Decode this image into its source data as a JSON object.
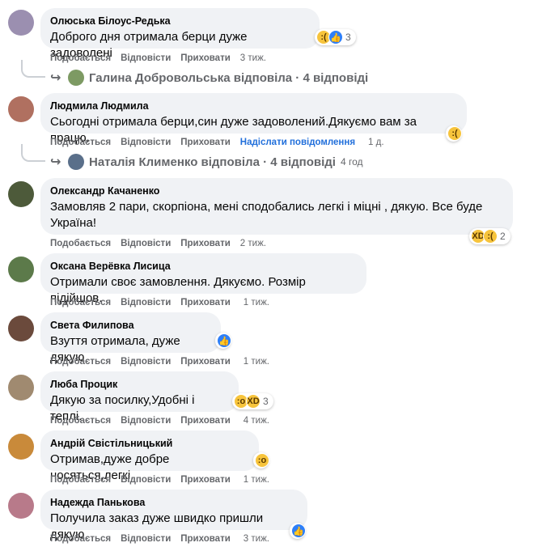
{
  "actions": {
    "like": "Подобається",
    "reply": "Відповісти",
    "hide": "Приховати",
    "send_message": "Надіслати повідомлення"
  },
  "comments": [
    {
      "author": "Олюська Білоус-Редька",
      "text": "Доброго дня отримала берци дуже задоволені",
      "time": "3 тиж.",
      "reaction_count": "3",
      "reactions": [
        "sad-face-icon",
        "like-icon"
      ]
    },
    {
      "author": "Людмила Людмила",
      "text": "Сьогодні отримала берци,син дуже задоволений.Дякуємо вам за працю.",
      "time": "1 д.",
      "reaction_count": "",
      "reactions": [
        "sad-face-icon"
      ]
    },
    {
      "author": "Олександр Качаненко",
      "text": "Замовляв 2 пари, скорпіона, мені сподобались легкі і міцні , дякую. Все буде Україна!",
      "time": "2 тиж.",
      "reaction_count": "2",
      "reactions": [
        "haha-icon",
        "sad-face-icon"
      ]
    },
    {
      "author": "Оксана Верёвка Лисица",
      "text": "Отримали своє замовлення. Дякуємо. Розмір підійшов.",
      "time": "1 тиж."
    },
    {
      "author": "Света Филипова",
      "text": "Взуття отримала, дуже дякую",
      "time": "1 тиж.",
      "reactions": [
        "like-icon"
      ]
    },
    {
      "author": "Люба Процик",
      "text": "Дякую за посилку,Удобні і теплі.",
      "time": "4 тиж.",
      "reaction_count": "3",
      "reactions": [
        "wow-icon",
        "haha-icon"
      ]
    },
    {
      "author": "Андрій Свістільницький",
      "text": "Отримав,дуже добре носяться,легкі.",
      "time": "1 тиж.",
      "reactions": [
        "wow-icon"
      ]
    },
    {
      "author": "Надежда Панькова",
      "text": "Получила заказ дуже швидко пришли дякую",
      "time": "3 тиж.",
      "reactions": [
        "like-icon"
      ]
    }
  ],
  "replies": [
    {
      "text": "Галина Добровольська відповіла · 4 відповіді",
      "time": ""
    },
    {
      "text": "Наталія Клименко відповіла · 4 відповіді",
      "time": "4 год"
    }
  ],
  "colors": {
    "bubble": "#f0f2f5",
    "meta": "#65676b",
    "link_blue": "#216fdb",
    "like_blue": "#2d7ff9",
    "emoji_yellow": "#f7c43c"
  }
}
